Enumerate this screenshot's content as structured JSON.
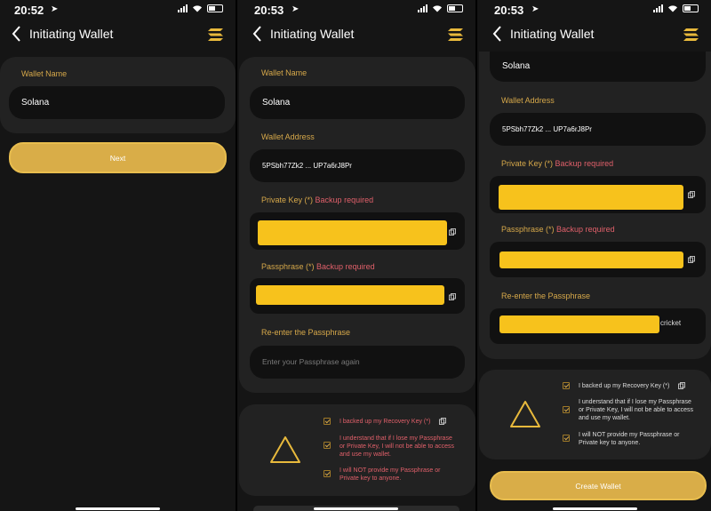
{
  "screens": [
    {
      "time": "20:52",
      "title": "Initiating Wallet",
      "wallet_name_label": "Wallet Name",
      "wallet_name_value": "Solana",
      "next_button": "Next"
    },
    {
      "time": "20:53",
      "title": "Initiating Wallet",
      "wallet_name_label": "Wallet Name",
      "wallet_name_value": "Solana",
      "wallet_address_label": "Wallet Address",
      "wallet_address_value": "5PSbh77Zk2 ... UP7a6rJ8Pr",
      "private_key_label": "Private Key (*)",
      "private_key_note": "Backup required",
      "passphrase_label": "Passphrase (*)",
      "passphrase_note": "Backup required",
      "reenter_label": "Re-enter the Passphrase",
      "reenter_placeholder": "Enter your Passphrase again",
      "check_1": "I backed up my Recovery Key (*)",
      "check_2": "I understand that if I lose my Passphrase or Private Key, I will not be able to access and use my wallet.",
      "check_3": "I will NOT provide my Passphrase or Private key to anyone."
    },
    {
      "time": "20:53",
      "title": "Initiating Wallet",
      "wallet_name_value": "Solana",
      "wallet_address_label": "Wallet Address",
      "wallet_address_value": "5PSbh77Zk2 ... UP7a6rJ8Pr",
      "private_key_label": "Private Key (*)",
      "private_key_note": "Backup required",
      "passphrase_label": "Passphrase (*)",
      "passphrase_note": "Backup required",
      "reenter_label": "Re-enter the Passphrase",
      "reenter_suffix": "cricket",
      "check_1": "I backed up my Recovery Key (*)",
      "check_2": "I understand that if I lose my Passphrase or Private Key, I will not be able to access and use my wallet.",
      "check_3": "I will NOT provide my Passphrase or Private key to anyone.",
      "create_button": "Create Wallet"
    }
  ],
  "icons": {
    "back": "chevron-left-icon",
    "logo": "solana-logo-icon",
    "copy": "copy-icon",
    "warning": "warning-triangle-icon",
    "checkbox": "checkbox-checked-icon"
  },
  "colors": {
    "background": "#151515",
    "card": "#222222",
    "field": "#111111",
    "label_gold": "#d6a84a",
    "required_red": "#e0606a",
    "button_gold": "#d9ad48",
    "mask_yellow": "#f7c21c"
  }
}
